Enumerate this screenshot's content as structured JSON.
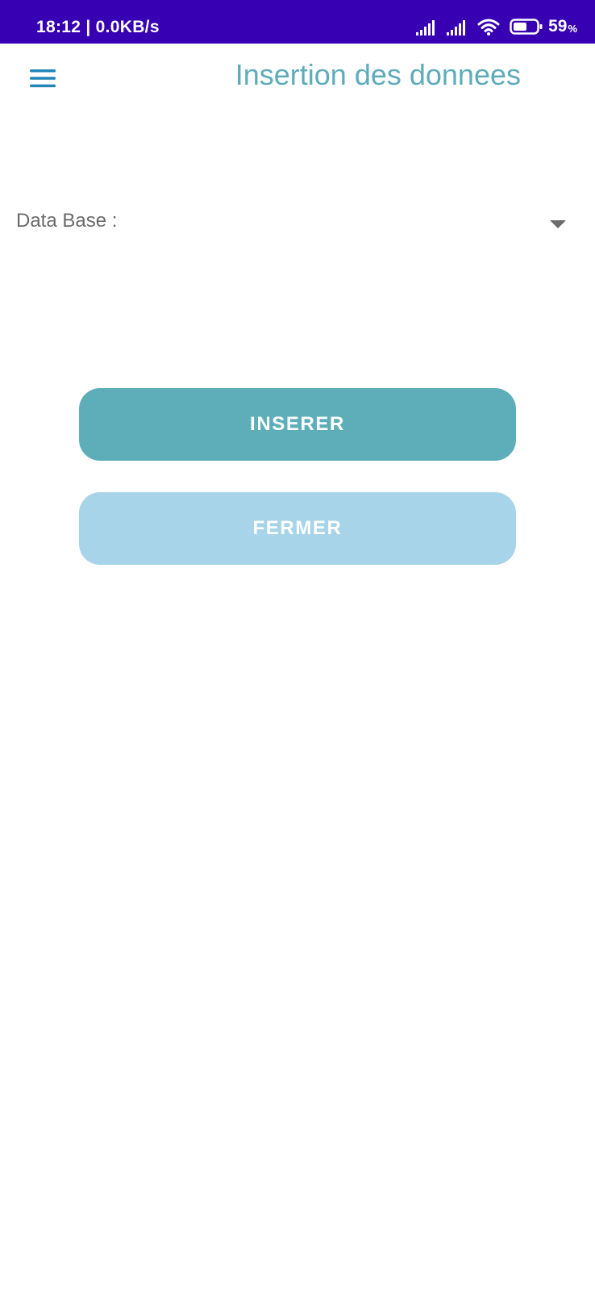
{
  "status_bar": {
    "time": "18:12 | 0.0KB/s",
    "battery_percent": "59",
    "battery_percent_sign": "%",
    "battery_level": 0.59,
    "background_color": "#3700b3",
    "icons": [
      "signal-icon",
      "signal-icon",
      "wifi-icon",
      "battery-icon"
    ]
  },
  "app_bar": {
    "menu_icon": "hamburger-menu-icon",
    "title": "Insertion des donnees",
    "title_color": "#5eacb9"
  },
  "form": {
    "database_label": "Data Base :",
    "database_selected_value": "",
    "dropdown_icon": "dropdown-arrow-icon"
  },
  "buttons": {
    "insert_label": "INSERER",
    "insert_color": "#5eaeba",
    "close_label": "FERMER",
    "close_color": "#a8d4e9"
  }
}
